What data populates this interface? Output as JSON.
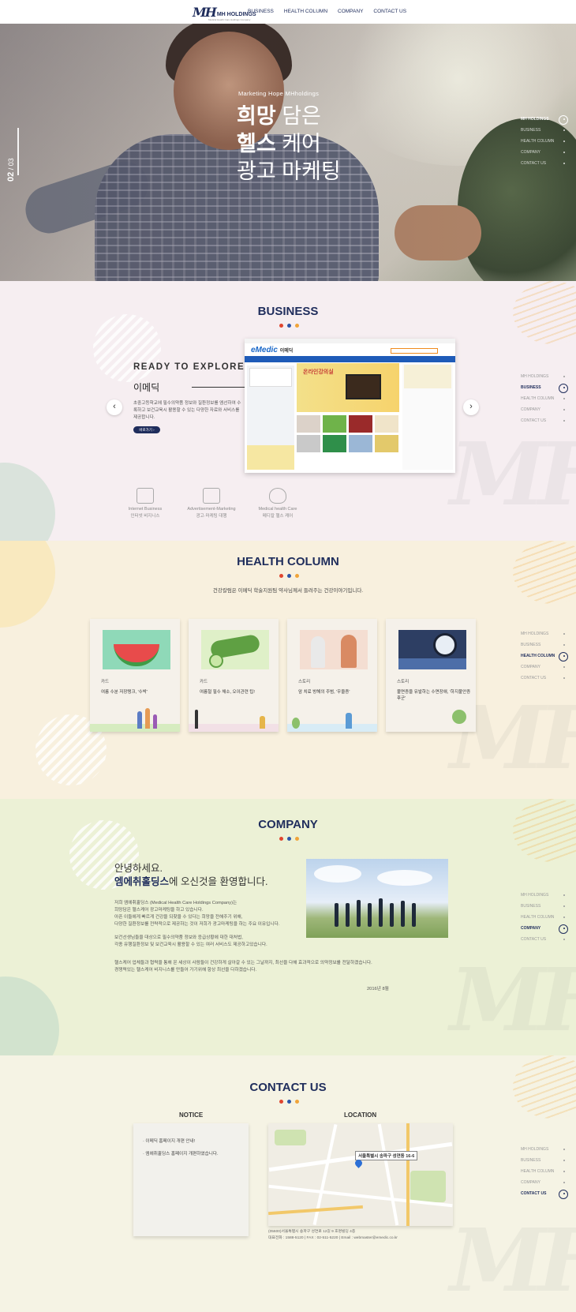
{
  "header": {
    "logo_mark": "MH",
    "logo_text": "MH HOLDINGS",
    "logo_sub": "Medical Health Care Holdings Company",
    "nav": [
      "BUSINESS",
      "HEALTH COLUMN",
      "COMPANY",
      "CONTACT US"
    ]
  },
  "hero": {
    "eyebrow": "Marketing Hope MHholdings",
    "line1_bold": "희망",
    "line1_rest": " 담은",
    "line2_bold": "헬스",
    "line2_rest": " 케어",
    "line3": "광고 마케팅",
    "slide_current": "02",
    "slide_total": "/ 03"
  },
  "side_nav": [
    "MH HOLDINGS",
    "BUSINESS",
    "HEALTH COLUMN",
    "COMPANY",
    "CONTACT US"
  ],
  "business": {
    "title": "BUSINESS",
    "ready": "READY TO EXPLORE",
    "name": "이메딕",
    "desc": "초중고등학교에 필수의약품 정보와 질환정보를 엠선하여 수록하고 보건교육시 활용할 수 있는 다양한 자료와 서비스를 제공합니다.",
    "button": "바로가기 ›",
    "prev": "‹",
    "next": "›",
    "shot_logo": "eMedic",
    "shot_logo_ko": "이메딕",
    "shot_banner": "온라인강의실",
    "categories": [
      {
        "en": "Internet Business",
        "ko": "인터넷 비지니스"
      },
      {
        "en": "Advertisement-Marketing",
        "ko": "광고·마케팅 대행"
      },
      {
        "en": "Medical health Care",
        "ko": "메디칼 헬스 케어"
      }
    ]
  },
  "health": {
    "title": "HEALTH COLUMN",
    "intro": "건강칼럼은 이메딕 학술지원팀 약사님께서 들려주는 건강이야기입니다.",
    "cards": [
      {
        "tag": "카드",
        "title": "여름 수분 저장탱크, '수박'"
      },
      {
        "tag": "카드",
        "title": "여름철 필수 채소, 오이관련 팁!"
      },
      {
        "tag": "스토리",
        "title": "암 치료 방해의 주범, '우울증'"
      },
      {
        "tag": "스토리",
        "title": "불면증을 유발하는 수면장애, '하지불안증후군'"
      }
    ]
  },
  "company": {
    "title": "COMPANY",
    "hello1": "안녕하세요.",
    "hello2_bold": "엠에취홀딩스",
    "hello2_rest": "에 오신것을 환영합니다.",
    "p1": "저희 엠에취홀딩스 (Medical Health Care Holdings Company)는\n희망담은 헬스케어 광고마케팅을 하고 있습니다.\n아픈 이들에게 빠르게 건강을 되찾을 수 있다는 희망을 전해주기 위해,\n다양한 질환정보를 전략적으로 제공하는 것이 저희가 광고마케팅을 하는 주요 이유입니다.",
    "p2": "보건선생님들을 대상으로 필수의약품 정보와 응급상황에 대한 대처법,\n각종 유행질환정보 및 보건교육시 활용할 수 있는 여러 서비스도 제공하고있습니다.",
    "p3": "헬스케어 업체들과 협력을 통해 온 세상이 사람들이 건강하게 살아갈 수 있는 그날까지, 최선을 다해 효과적으로 의약정보를 전달하겠습니다.\n경쟁력있는 헬스케어 비지니스를 만들어 가기위해 항상 최선을 다하겠습니다.",
    "date": "2016년 8월"
  },
  "contact": {
    "title": "CONTACT US",
    "notice_heading": "NOTICE",
    "location_heading": "LOCATION",
    "notices": [
      "· 이메딕 홈페이지 개편 안내!",
      "· 엠에취홀딩스 홈페이지 개편하였습니다."
    ],
    "map_label": "서울특별시 송파구 성연동 16-6",
    "addr1": "(05600)서울특별시 송파구 성연로 12길 9 호명빌딩 4층",
    "addr2": "대표전화 :  1588-5120   |   FAX : 02-511-5220   |   Email : webmaster@emedic.co.kr"
  },
  "colors": {
    "navy": "#1f2d5c",
    "red": "#e0452f",
    "blue": "#2c55a9",
    "orange": "#f0a43a"
  }
}
